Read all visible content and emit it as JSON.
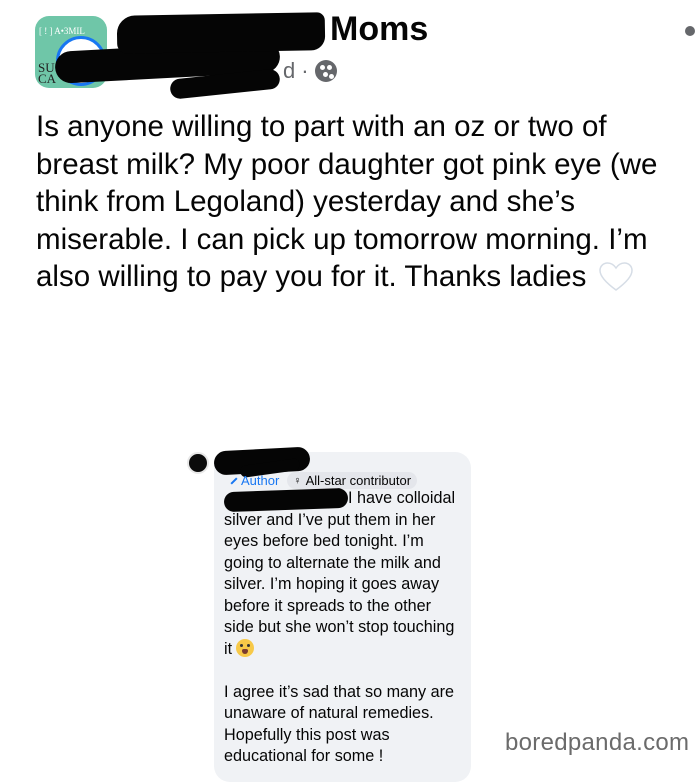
{
  "post": {
    "group_avatar": {
      "line1": "[ ! ] A•3MIL",
      "line2": "SU\nCA"
    },
    "group_name": "Moms",
    "time": "d",
    "visibility_icon": "group-privacy-icon",
    "body_text": "Is anyone willing to part with an oz or two of breast milk? My poor daughter got pink eye (we think from Legoland) yesterday and she’s miserable. I can pick up tomorrow morning. I’m also willing to pay you for it. Thanks ladies",
    "emoji": "white-heart-icon"
  },
  "comment": {
    "author_badge": "Author",
    "contributor_badge": "All-star contributor",
    "text_part1": "I have colloidal silver and I’ve put them in her eyes before bed tonight. I’m going to alternate the milk and silver. I’m hoping it goes away before it spreads to the other side but she won’t stop touching it",
    "emoji": "crying-face-icon",
    "text_part2": "I agree it’s sad that so many are unaware of natural remedies. Hopefully this post was educational for some !"
  },
  "watermark": "boredpanda.com",
  "colors": {
    "accent": "#1877f2",
    "bubble": "#f0f2f5",
    "text": "#050505",
    "secondary": "#65676b"
  }
}
